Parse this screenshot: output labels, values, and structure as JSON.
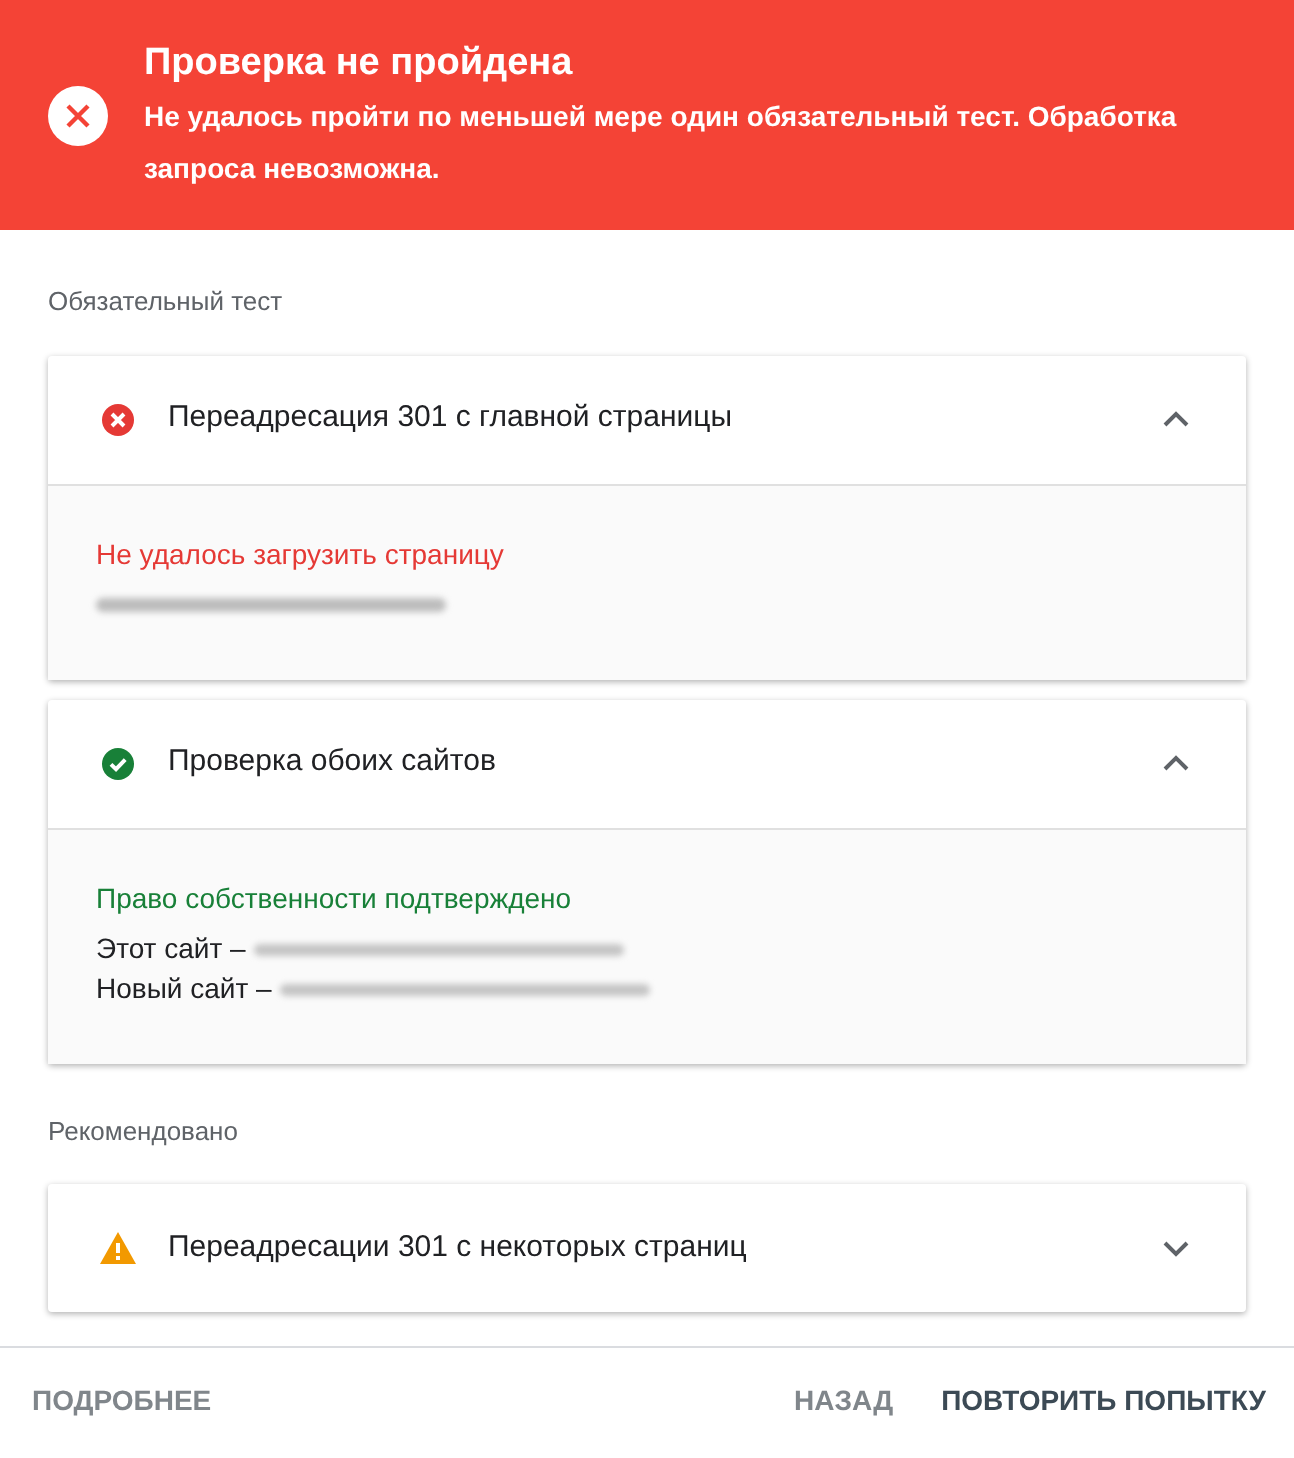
{
  "banner": {
    "title": "Проверка не пройдена",
    "message": "Не удалось пройти по меньшей мере один обязательный тест. Обработка запроса невозможна."
  },
  "sections": [
    {
      "heading": "Обязательный тест",
      "checks": [
        {
          "kind": "error",
          "title": "Переадресация 301 с главной страницы",
          "expanded": true,
          "details": {
            "kind": "error",
            "text": "Не удалось загрузить страницу",
            "lines": [
              {
                "kind": "redacted"
              }
            ]
          }
        },
        {
          "kind": "success",
          "title": "Проверка обоих сайтов",
          "expanded": true,
          "details": {
            "kind": "success",
            "text": "Право собственности подтверждено",
            "lines": [
              {
                "kind": "labeled",
                "label": "Этот сайт –"
              },
              {
                "kind": "labeled",
                "label": "Новый сайт –"
              }
            ]
          }
        }
      ]
    },
    {
      "heading": "Рекомендовано",
      "checks": [
        {
          "kind": "warning",
          "title": "Переадресации 301 с некоторых страниц",
          "expanded": false
        }
      ]
    }
  ],
  "footer": {
    "left_button": "ПОДРОБНЕЕ",
    "buttons": [
      {
        "label": "НАЗАД",
        "primary": false
      },
      {
        "label": "ПОВТОРИТЬ ПОПЫТКУ",
        "primary": true
      }
    ]
  }
}
